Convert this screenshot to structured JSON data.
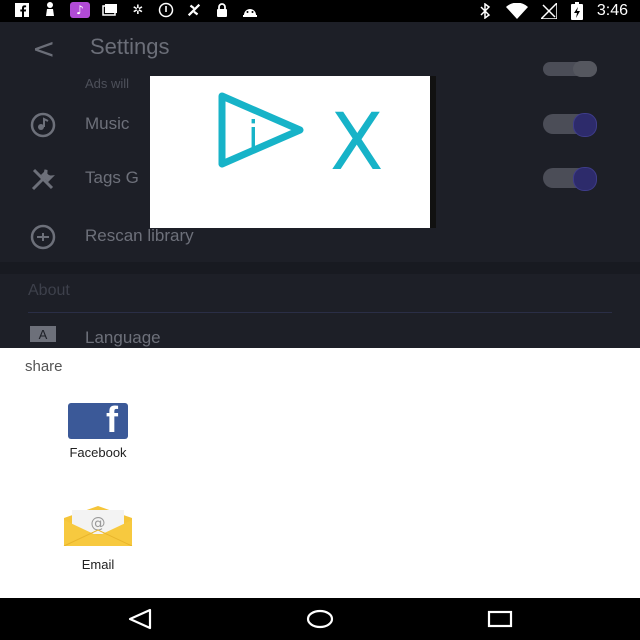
{
  "status_bar": {
    "left_icons": [
      "facebook-icon",
      "chess-icon",
      "music-icon",
      "cards-icon",
      "settings-icon",
      "alert-circle-icon",
      "fan-icon",
      "lock-icon",
      "android-icon"
    ],
    "right_icons": [
      "bluetooth-icon",
      "wifi-icon",
      "signal-off-icon",
      "battery-charging-icon"
    ],
    "time": "3:46"
  },
  "settings": {
    "title": "Settings",
    "ads_text": "Ads will",
    "items": [
      {
        "label": "Music",
        "icon": "music-note-icon",
        "toggle": true
      },
      {
        "label": "Tags G",
        "icon": "tools-icon",
        "toggle": true
      },
      {
        "label": "Rescan library",
        "icon": "rescan-icon"
      }
    ],
    "section_about": "About",
    "language_label": "Language",
    "language_icon": "translate-icon"
  },
  "ad": {
    "brand_letter": "i",
    "close_glyph": "X",
    "accent": "#17b3c8"
  },
  "share_sheet": {
    "title": "share",
    "items": [
      {
        "label": "Facebook",
        "icon": "facebook-app-icon",
        "glyph": "f"
      },
      {
        "label": "Email",
        "icon": "email-app-icon",
        "glyph": "@"
      }
    ]
  },
  "nav_bar": {
    "buttons": [
      "back-triangle-icon",
      "home-circle-icon",
      "recents-square-icon"
    ]
  },
  "colors": {
    "app_bg": "#1d1f27",
    "toggle_knob": "#2d2b6b",
    "facebook": "#3b5998",
    "email_yellow": "#f5c53a"
  }
}
